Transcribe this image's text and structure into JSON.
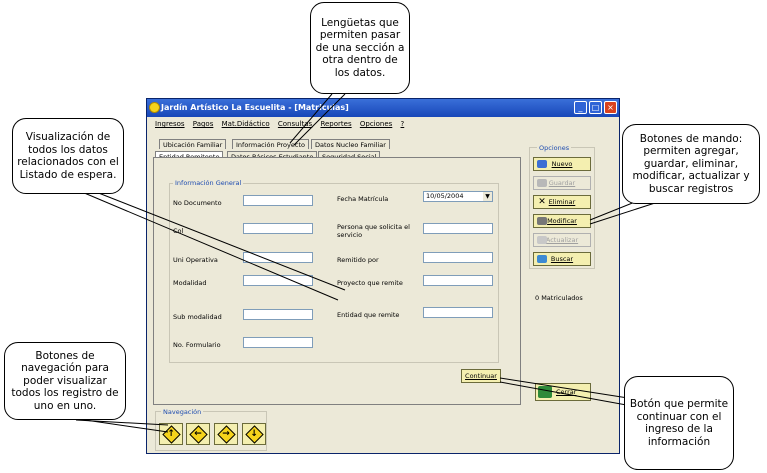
{
  "window": {
    "title": "Jardín Artístico La Escuelita - [Matriculas]"
  },
  "menu": [
    "Ingresos",
    "Pagos",
    "Mat.Didáctico",
    "Consultas",
    "Reportes",
    "Opciones",
    "?"
  ],
  "tabs": {
    "row1": [
      "Ubicación Familiar",
      "Información Proyecto",
      "Datos Nucleo Familiar"
    ],
    "row2": [
      "Entidad Remitente",
      "Datos Básicos Estudiante",
      "Seguridad Social"
    ]
  },
  "form": {
    "group_title": "Información General",
    "left_labels": [
      "No Documento",
      "Col",
      "Uni Operativa",
      "Modalidad",
      "Sub modalidad",
      "No. Formulario"
    ],
    "right_labels": [
      "Fecha Matrícula",
      "Persona que solicita el servicio",
      "Remitido por",
      "Proyecto que remite",
      "Entidad que remite"
    ],
    "fecha_value": "10/05/2004"
  },
  "options": {
    "title": "Opciones",
    "buttons": [
      "Nuevo",
      "Guardar",
      "Eliminar",
      "Modificar",
      "Actualizar",
      "Buscar"
    ]
  },
  "matriculados": "0 Matriculados",
  "continuar": "Continuar",
  "cerrar": "Cerrar",
  "navigation": {
    "title": "Navegación"
  },
  "callouts": {
    "tabs": "Lengüetas que permiten pasar de una sección a otra dentro de los datos.",
    "visualization": "Visualización de todos los datos relacionados con el Listado de espera.",
    "commands": "Botones de mando: permiten agregar, guardar, eliminar, modificar, actualizar y buscar registros",
    "navigation": "Botones de navegación para poder visualizar todos los registro de uno en uno.",
    "continue": "Botón que permite continuar con el ingreso de la información"
  }
}
